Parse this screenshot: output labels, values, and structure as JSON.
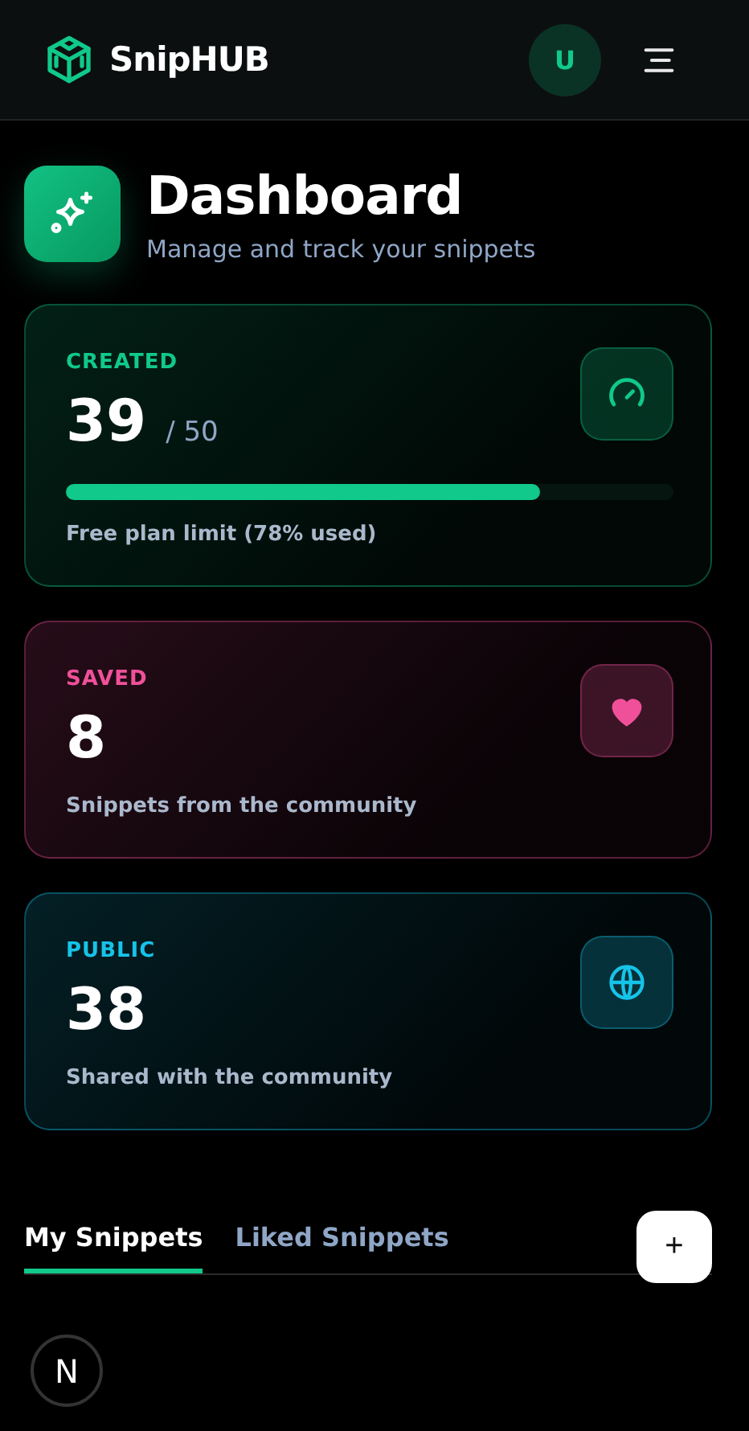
{
  "header": {
    "brand": "SnipHUB",
    "avatar": "U"
  },
  "page": {
    "title": "Dashboard",
    "subtitle": "Manage and track your snippets"
  },
  "stats": [
    {
      "kind": "gauge",
      "color": "#10c98a",
      "label": "CREATED",
      "value": "39",
      "total": "/ 50",
      "level": 0.78,
      "note": "Free plan limit (78% used)"
    },
    {
      "kind": "heart",
      "color": "#f0509a",
      "label": "SAVED",
      "value": "8",
      "note": "Snippets from the community"
    },
    {
      "kind": "globe",
      "color": "#16c3e8",
      "label": "PUBLIC",
      "value": "38",
      "note": "Shared with the community"
    }
  ],
  "tabs": [
    {
      "label": "My Snippets",
      "selected": true
    },
    {
      "label": "Liked Snippets",
      "selected": false
    }
  ],
  "add_button": "+",
  "dev_badge": "N"
}
